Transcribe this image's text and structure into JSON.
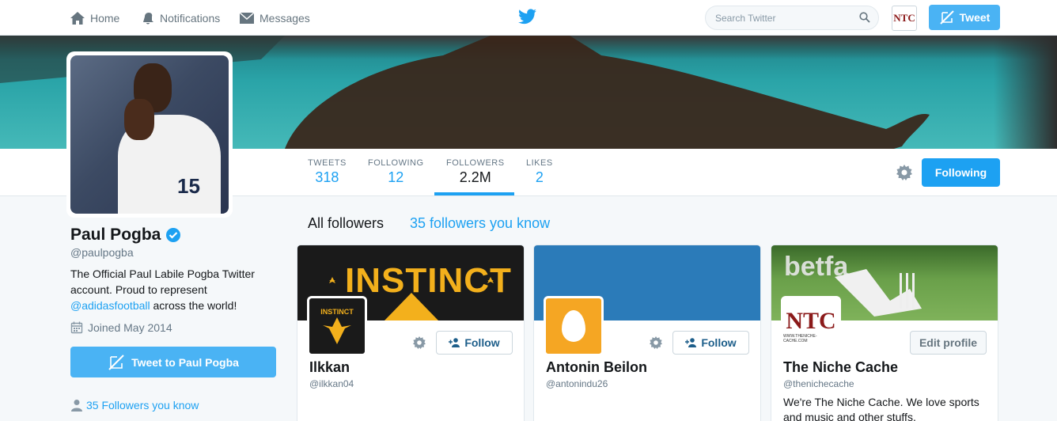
{
  "nav": {
    "home": "Home",
    "notifications": "Notifications",
    "messages": "Messages",
    "search_placeholder": "Search Twitter",
    "tweet": "Tweet",
    "avatar_text": "NTC"
  },
  "stats": [
    {
      "label": "TWEETS",
      "value": "318"
    },
    {
      "label": "FOLLOWING",
      "value": "12"
    },
    {
      "label": "FOLLOWERS",
      "value": "2.2M"
    },
    {
      "label": "LIKES",
      "value": "2"
    }
  ],
  "following_button": "Following",
  "profile": {
    "name": "Paul Pogba",
    "handle": "@paulpogba",
    "bio_prefix": "The Official Paul Labile Pogba Twitter account. Proud to represent ",
    "bio_link": "@adidasfootball",
    "bio_suffix": " across the world!",
    "joined": "Joined May 2014",
    "tweet_to": "Tweet to Paul Pogba",
    "followers_you_know": "35 Followers you know",
    "avatar_number": "15"
  },
  "follower_tabs": {
    "all": "All followers",
    "known": "35 followers you know"
  },
  "cards": [
    {
      "name": "Ilkkan",
      "handle": "@ilkkan04",
      "button": "Follow",
      "banner_text": "INSTINCT",
      "avatar_text": "INSTINCT",
      "bio": ""
    },
    {
      "name": "Antonin Beilon",
      "handle": "@antonindu26",
      "button": "Follow",
      "bio": ""
    },
    {
      "name": "The Niche Cache",
      "handle": "@thenichecache",
      "button": "Edit profile",
      "banner_text": "betfa",
      "avatar_text": "NTC",
      "avatar_subtext": "WWW.THENICHE-CACHE.COM",
      "bio": "We're The Niche Cache. We love sports and music and other stuffs."
    }
  ],
  "colors": {
    "accent": "#1da1f2",
    "button_light": "#4ab3f4",
    "background": "#f5f8fa"
  }
}
